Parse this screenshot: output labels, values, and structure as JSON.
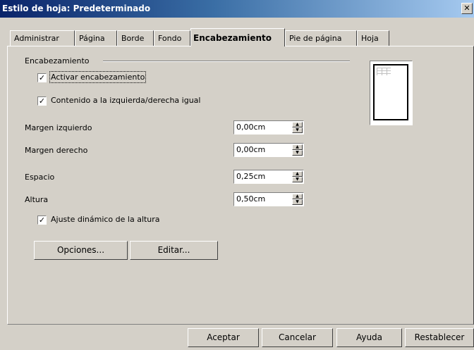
{
  "window": {
    "title": "Estilo de hoja: Predeterminado",
    "close_glyph": "✕"
  },
  "tabs": [
    {
      "label": "Administrar"
    },
    {
      "label": "Página"
    },
    {
      "label": "Borde"
    },
    {
      "label": "Fondo"
    },
    {
      "label": "Encabezamiento",
      "active": true
    },
    {
      "label": "Pie de página"
    },
    {
      "label": "Hoja"
    }
  ],
  "section": {
    "title": "Encabezamiento"
  },
  "checkboxes": {
    "activate": {
      "label": "Activar encabezamiento",
      "checked": true,
      "mnemonic": "A"
    },
    "same_content": {
      "label": "Contenido a la izquierda/derecha igual",
      "checked": true,
      "mnemonic": "C"
    },
    "autofit": {
      "label": "Ajuste dinámico de la altura",
      "checked": true,
      "mnemonic": "t"
    }
  },
  "fields": {
    "left_margin": {
      "label": "Margen izquierdo",
      "value": "0,00cm"
    },
    "right_margin": {
      "label": "Margen derecho",
      "value": "0,00cm"
    },
    "spacing": {
      "label": "Espacio",
      "value": "0,25cm"
    },
    "height": {
      "label": "Altura",
      "value": "0,50cm"
    }
  },
  "buttons": {
    "options": "Opciones...",
    "edit": "Editar...",
    "ok": "Aceptar",
    "cancel": "Cancelar",
    "help": "Ayuda",
    "reset": "Restablecer"
  },
  "check_glyph": "✓",
  "icons": {
    "close": "close-icon",
    "spin_up": "spin-up-icon",
    "spin_down": "spin-down-icon",
    "preview": "page-preview"
  }
}
